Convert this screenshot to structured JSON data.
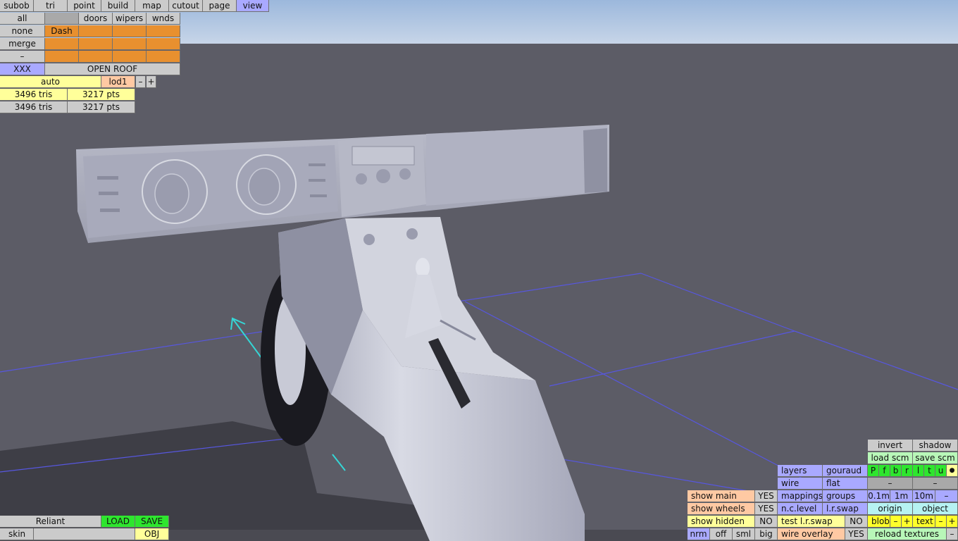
{
  "menu": [
    "subob",
    "tri",
    "point",
    "build",
    "map",
    "cutout",
    "page",
    "view"
  ],
  "menu_active": "view",
  "parts": {
    "row1": [
      "all",
      "",
      "doors",
      "wipers",
      "wnds"
    ],
    "none": "none",
    "merge": "merge",
    "dash": "–",
    "selected": "Dash",
    "xxx": "XXX",
    "open_roof": "OPEN ROOF"
  },
  "lod": {
    "auto": "auto",
    "level": "lod1",
    "minus": "–",
    "plus": "+"
  },
  "stats": [
    {
      "tris": "3496 tris",
      "pts": "3217 pts"
    },
    {
      "tris": "3496 tris",
      "pts": "3217 pts"
    }
  ],
  "bottom_left": {
    "car": "Reliant",
    "load": "LOAD",
    "save": "SAVE",
    "skin": "skin",
    "skin_value": "",
    "obj": "OBJ"
  },
  "right_panel": {
    "invert": "invert",
    "shadow": "shadow",
    "load_scm": "load scm",
    "save_scm": "save scm",
    "pfbrltu": [
      "P",
      "f",
      "b",
      "r",
      "l",
      "t",
      "u"
    ],
    "dot": "●",
    "layers": "layers",
    "gouraud": "gouraud",
    "wire": "wire",
    "flat": "flat",
    "dash1": "–",
    "dash2": "–",
    "mappings": "mappings",
    "groups": "groups",
    "scale": [
      "0.1m",
      "1m",
      "10m",
      "–"
    ],
    "n_c_level": "n.c.level",
    "l_r_swap": "l.r.swap",
    "origin": "origin",
    "object": "object",
    "test_lr_swap": "test l.r.swap",
    "test_no": "NO",
    "blob": "blob",
    "blob_minus": "–",
    "blob_plus": "+",
    "text": "text",
    "text_minus": "–",
    "text_plus": "+",
    "wire_overlay": "wire overlay",
    "wire_overlay_val": "YES",
    "reload_textures": "reload textures",
    "reload_minus": "–"
  },
  "show": {
    "main": "show main",
    "main_val": "YES",
    "wheels": "show wheels",
    "wheels_val": "YES",
    "hidden": "show hidden",
    "hidden_val": "NO",
    "sizes": [
      "nrm",
      "off",
      "sml",
      "big"
    ]
  }
}
